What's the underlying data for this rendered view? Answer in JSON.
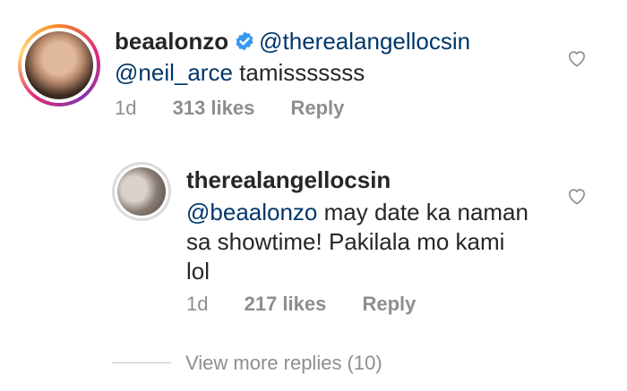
{
  "comment": {
    "username": "beaalonzo",
    "mention1": "@therealangellocsin",
    "mention2": "@neil_arce",
    "text": "tamisssssss",
    "age": "1d",
    "likes": "313 likes",
    "reply_label": "Reply"
  },
  "reply": {
    "username": "therealangellocsin",
    "mention": "@beaalonzo",
    "line1": "may date ka naman",
    "line2": "sa showtime! Pakilala mo kami",
    "line3": "lol",
    "age": "1d",
    "likes": "217 likes",
    "reply_label": "Reply"
  },
  "view_more": "View more replies (10)",
  "colors": {
    "verified": "#3897f0",
    "mention": "#00376b",
    "meta": "#8e8e8e"
  },
  "icons": {
    "like": "heart-outline-icon",
    "verified": "verified-badge-icon"
  }
}
